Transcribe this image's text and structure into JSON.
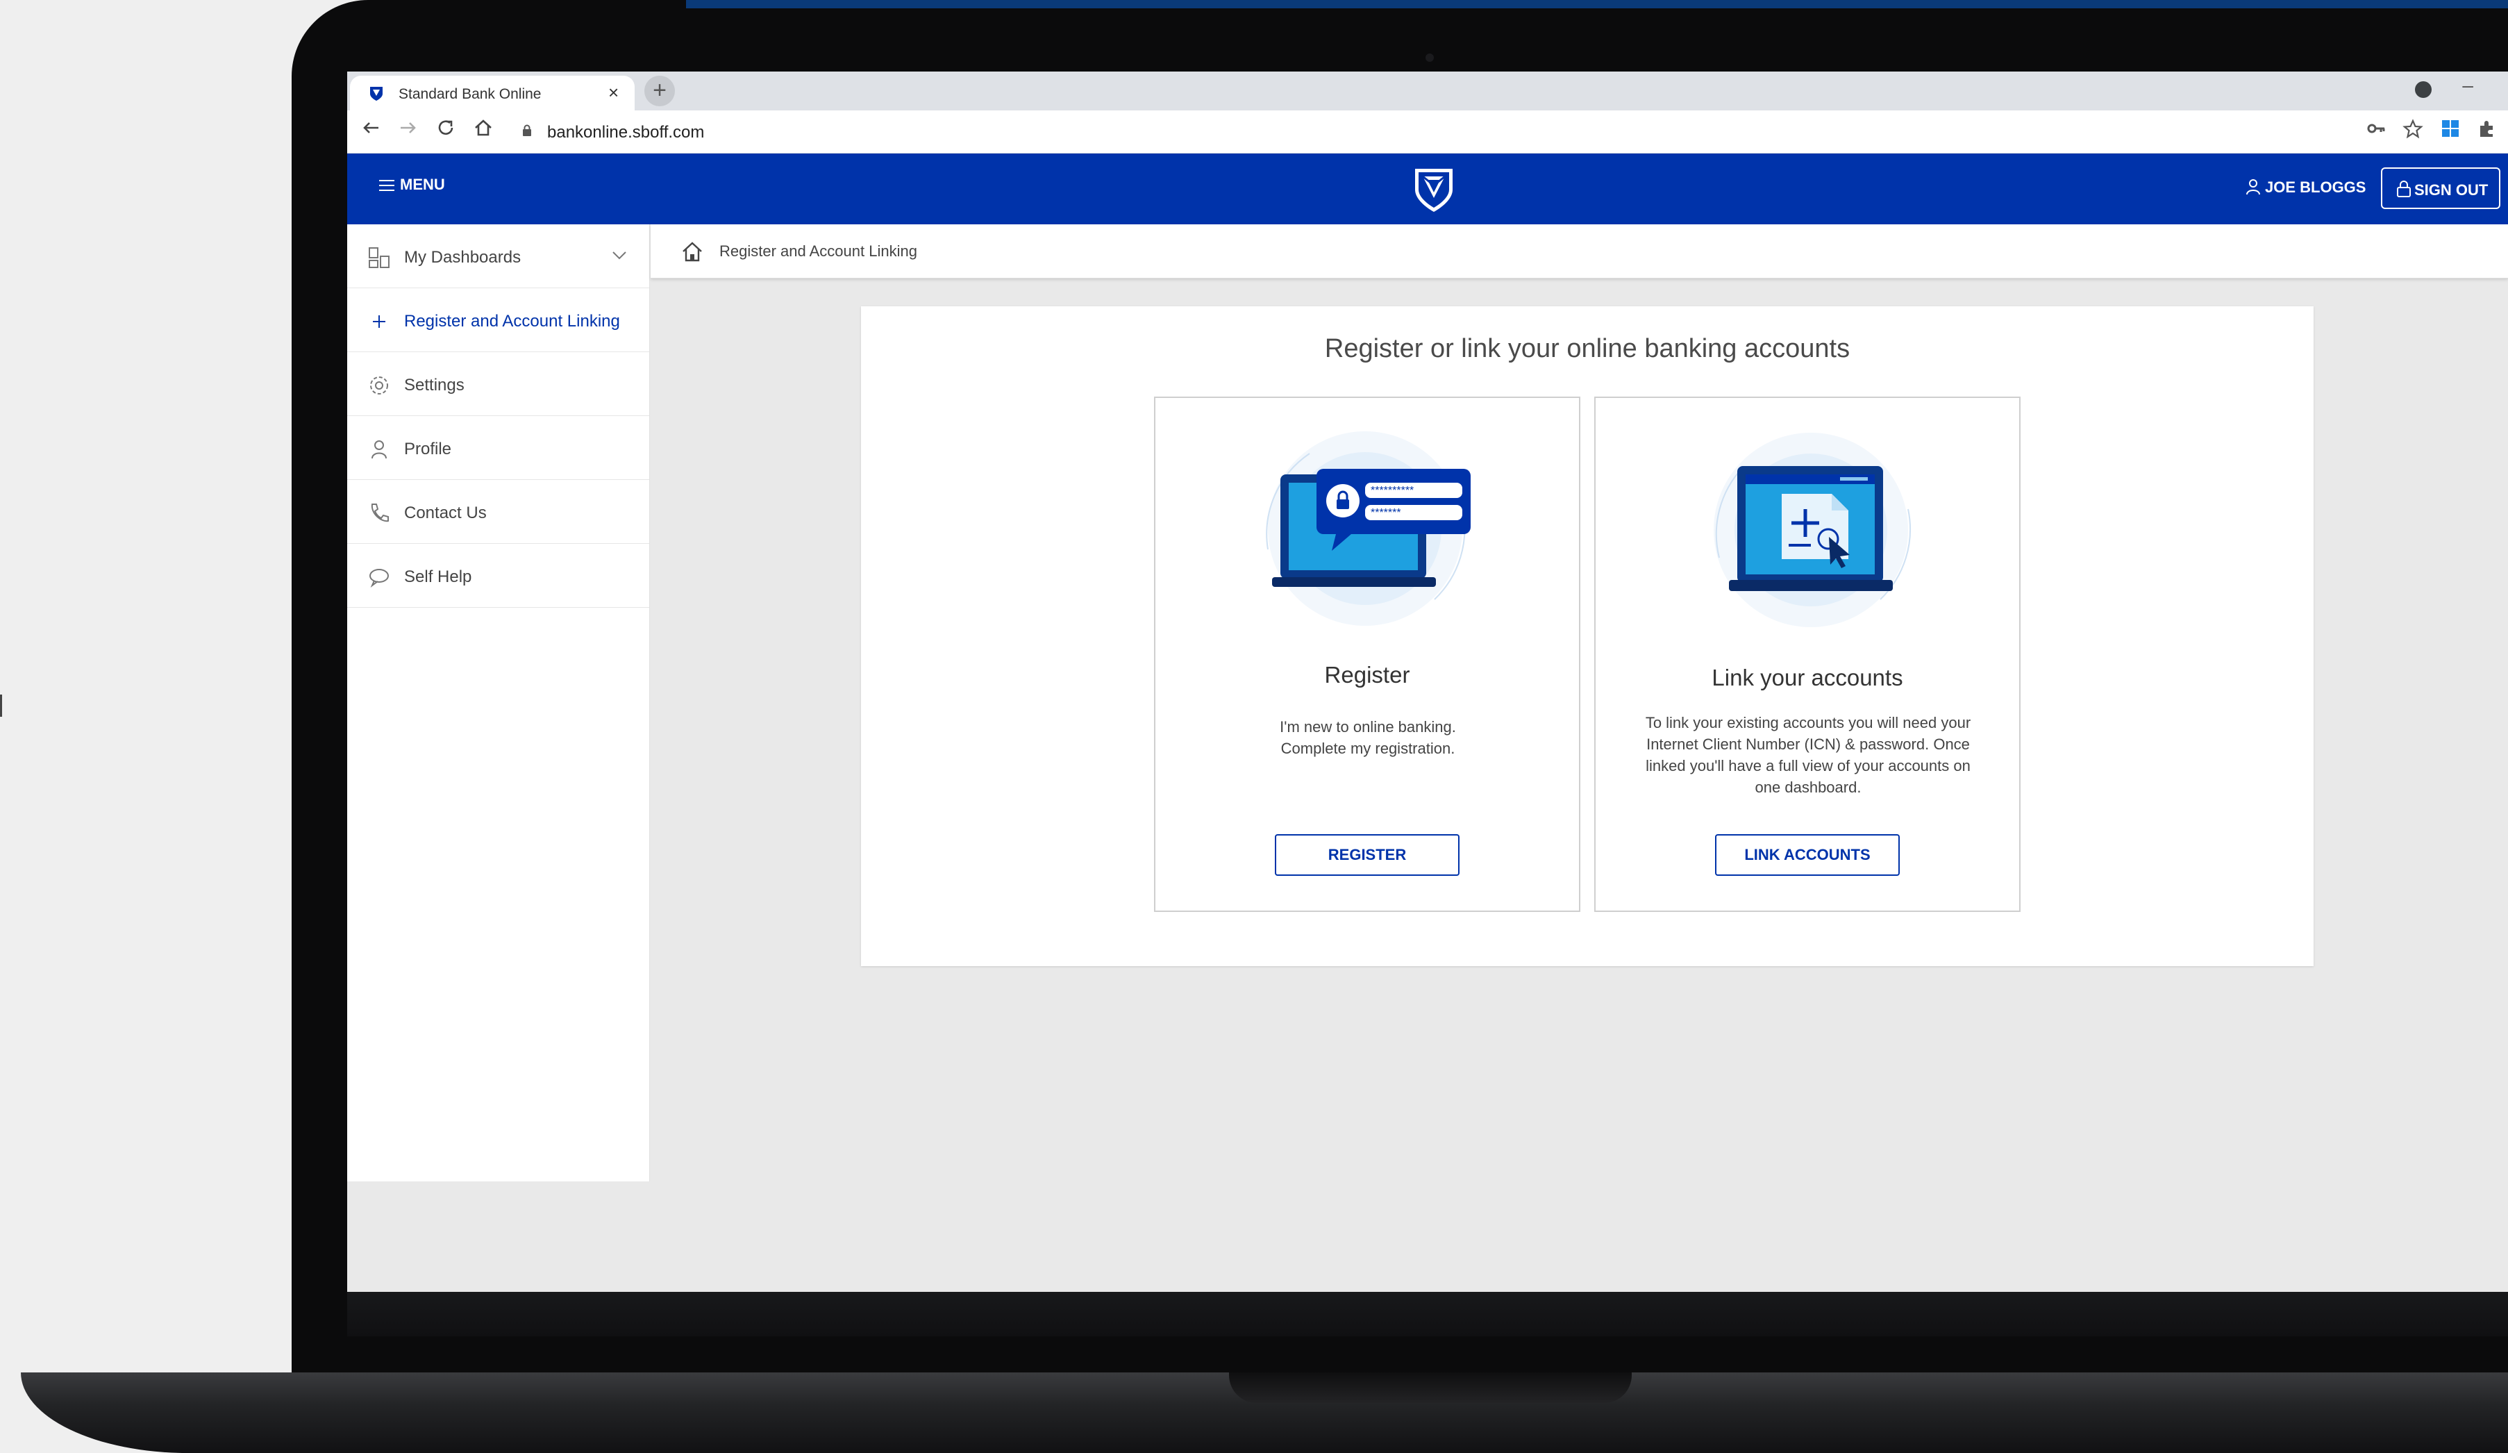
{
  "browser": {
    "tab_title": "Standard Bank Online",
    "tab_close": "×",
    "new_tab": "+",
    "url": "bankonline.sboff.com",
    "minimize": "–",
    "icons": [
      "back-icon",
      "forward-icon",
      "reload-icon",
      "home-icon",
      "lock-icon",
      "key-icon",
      "star-icon",
      "windows-icon",
      "extensions-icon"
    ]
  },
  "header": {
    "menu_label": "MENU",
    "user_label": "JOE BLOGGS",
    "signout_label": "SIGN OUT",
    "colors": {
      "brand_blue": "#0033aa"
    }
  },
  "sidebar": {
    "items": [
      {
        "label": "My Dashboards",
        "icon": "dashboard-icon"
      },
      {
        "label": "Register and Account Linking",
        "icon": "plus-icon"
      },
      {
        "label": "Settings",
        "icon": "gear-icon"
      },
      {
        "label": "Profile",
        "icon": "user-icon"
      },
      {
        "label": "Contact Us",
        "icon": "phone-icon"
      },
      {
        "label": "Self Help",
        "icon": "chat-icon"
      }
    ]
  },
  "breadcrumb": {
    "label": "Register and Account Linking"
  },
  "main": {
    "title": "Register or link your online banking accounts",
    "cards": [
      {
        "heading": "Register",
        "desc_lines": [
          "I'm new to online banking.",
          "Complete my registration."
        ],
        "button": "REGISTER"
      },
      {
        "heading": "Link your accounts",
        "desc_lines": [
          "To link your existing accounts you will need your",
          "Internet Client Number (ICN) & password. Once",
          "linked you'll have a full view of your accounts on",
          "one dashboard."
        ],
        "button": "LINK ACCOUNTS"
      }
    ]
  }
}
